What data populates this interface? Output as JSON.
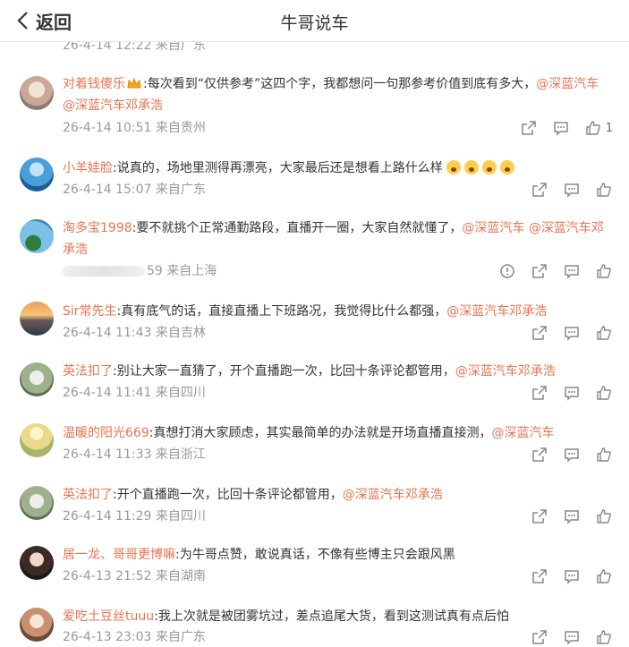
{
  "header": {
    "back_label": "返回",
    "title": "牛哥说车"
  },
  "partial_row": {
    "time": "26-4-14 12:22",
    "location": "来自广东"
  },
  "comments": [
    {
      "user": "对着钱傻乐",
      "text": ":每次看到“仅供参考”这四个字，我都想问一句那参考价值到底有多大，",
      "mentions": [
        "@深蓝汽车",
        "@深蓝汽车邓承浩"
      ],
      "time": "26-4-14 10:51",
      "location": "来自贵州",
      "likes": "1"
    },
    {
      "user": "小羊娃脸",
      "text": ":说真的，场地里测得再漂亮，大家最后还是想看上路什么样",
      "mentions": [],
      "time": "26-4-14 15:07",
      "location": "来自广东",
      "likes": ""
    },
    {
      "user": "淘多宝1998",
      "text": ":要不就挑个正常通勤路段，直播开一圈，大家自然就懂了，",
      "mentions": [
        "@深蓝汽车",
        "@深蓝汽车邓承浩"
      ],
      "time": "59",
      "location": "来自上海",
      "likes": ""
    },
    {
      "user": "Sir常先生",
      "text": ":真有底气的话，直接直播上下班路况，我觉得比什么都强，",
      "mentions": [
        "@深蓝汽车邓承浩"
      ],
      "time": "26-4-14 11:43",
      "location": "来自吉林",
      "likes": ""
    },
    {
      "user": "英法扣了",
      "text": ":别让大家一直猜了，开个直播跑一次，比回十条评论都管用，",
      "mentions": [
        "@深蓝汽车邓承浩"
      ],
      "time": "26-4-14 11:41",
      "location": "来自四川",
      "likes": ""
    },
    {
      "user": "温暖的阳光669",
      "text": ":真想打消大家顾虑，其实最简单的办法就是开场直播直接测，",
      "mentions": [
        "@深蓝汽车"
      ],
      "time": "26-4-14 11:33",
      "location": "来自浙江",
      "likes": ""
    },
    {
      "user": "英法扣了",
      "text": ":开个直播跑一次，比回十条评论都管用，",
      "mentions": [
        "@深蓝汽车邓承浩"
      ],
      "time": "26-4-14 11:29",
      "location": "来自四川",
      "likes": ""
    },
    {
      "user": "居一龙、哥哥更博嘛",
      "text": ":为牛哥点赞，敢说真话，不像有些博主只会跟风黑",
      "mentions": [],
      "time": "26-4-13 21:52",
      "location": "来自湖南",
      "likes": ""
    },
    {
      "user": "爱吃土豆丝tuuu",
      "text": ":我上次就是被团雾坑过，差点追尾大货，看到这测试真有点后怕",
      "mentions": [],
      "time": "26-4-13 23:03",
      "location": "来自广东",
      "likes": ""
    }
  ],
  "icons": {
    "share": "share-icon",
    "comment": "comment-icon",
    "like": "thumbs-up-icon",
    "report": "report-icon",
    "back": "chevron-left-icon"
  },
  "colors": {
    "accent": "#eb7350",
    "meta": "#999999",
    "text": "#333333"
  }
}
